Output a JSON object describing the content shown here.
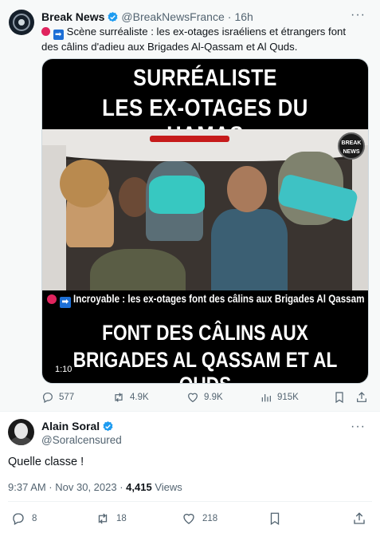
{
  "quoted_tweet": {
    "author_name": "Break News",
    "author_handle": "@BreakNewsFrance",
    "separator": "·",
    "time": "16h",
    "more_label": "···",
    "text": "Scène surréaliste : les ex-otages israéliens et étrangers font des câlins d'adieu aux Brigades Al-Qassam et Al Quds.",
    "media": {
      "title_line1": "SURRÉALISTE",
      "title_line2": "LES EX-OTAGES DU HAMAS",
      "logo_text": "BREAK NEWS",
      "ticker": "Incroyable : les ex-otages font des câlins aux Brigades Al Qassam",
      "bottom_line1": "FONT DES CÂLINS AUX",
      "bottom_line2": "BRIGADES AL QASSAM ET AL QUDS",
      "duration": "1:10"
    },
    "stats": {
      "replies": "577",
      "reposts": "4.9K",
      "likes": "9.9K",
      "views": "915K"
    }
  },
  "main_tweet": {
    "author_name": "Alain Soral",
    "author_handle": "@Soralcensured",
    "more_label": "···",
    "text": "Quelle classe !",
    "timestamp": "9:37 AM · Nov 30, 2023 ·",
    "views_count": "4,415",
    "views_label": "Views",
    "stats": {
      "replies": "8",
      "reposts": "18",
      "likes": "218"
    }
  },
  "colors": {
    "verified": "#1d9bf0",
    "muted": "#536471",
    "text": "#0f1419",
    "quoted_bg": "#f7f9f9"
  },
  "icons": [
    "reply-icon",
    "repost-icon",
    "like-icon",
    "views-icon",
    "bookmark-icon",
    "share-icon",
    "verified-icon",
    "more-icon"
  ]
}
